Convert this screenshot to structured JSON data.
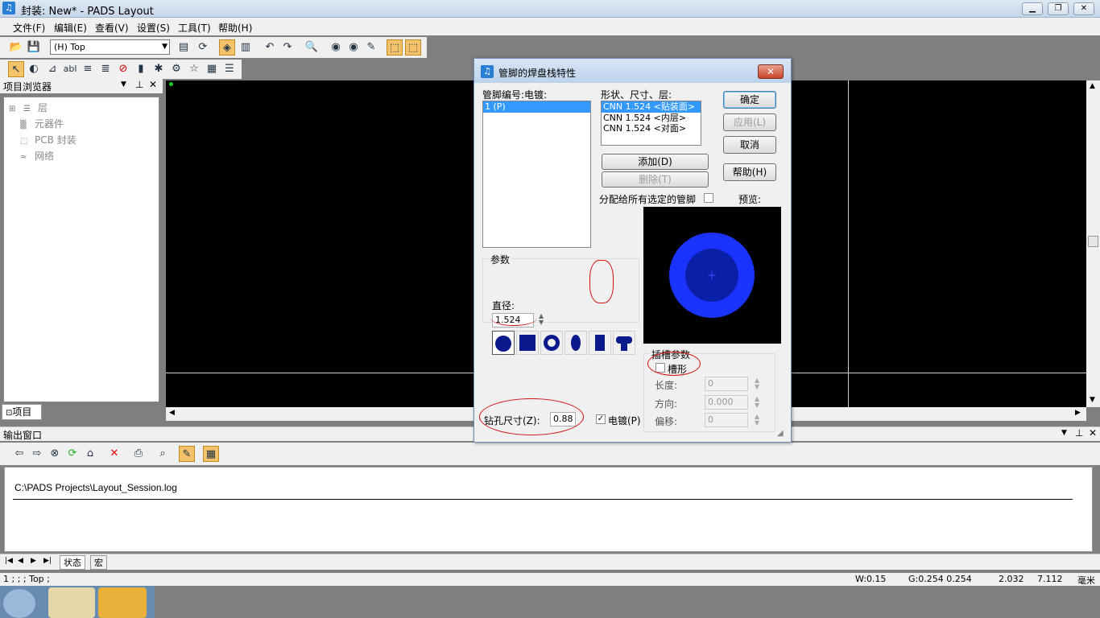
{
  "window": {
    "title": "封装: New* - PADS Layout",
    "min": "▁",
    "max": "❐",
    "close": "✕"
  },
  "menubar": [
    "文件(F)",
    "编辑(E)",
    "查看(V)",
    "设置(S)",
    "工具(T)",
    "帮助(H)"
  ],
  "toolbar": {
    "layer_select": "(H) Top"
  },
  "browser": {
    "title": "项目浏览器",
    "items": [
      "层",
      "元器件",
      "PCB 封装",
      "网络"
    ],
    "tab": "项目"
  },
  "output": {
    "title": "输出窗口",
    "log_path": "C:\\PADS Projects\\Layout_Session.log",
    "tabs": [
      "状态",
      "宏"
    ]
  },
  "statusbar": {
    "left": "1 ; ; ; Top ;",
    "w": "W:0.15",
    "g": "G:0.254 0.254",
    "x": "2.032",
    "y": "7.112",
    "unit": "毫米"
  },
  "dialog": {
    "title": "管脚的焊盘栈特性",
    "pin_label": "管脚编号:电镀:",
    "pins": [
      "1 (P)"
    ],
    "shape_label": "形状、尺寸、层:",
    "shapes": [
      "CNN 1.524 <贴装面>",
      "CNN 1.524 <内层>",
      "CNN 1.524 <对面>"
    ],
    "buttons": {
      "ok": "确定",
      "apply": "应用(L)",
      "cancel": "取消",
      "help": "帮助(H)",
      "add": "添加(D)",
      "delete": "删除(T)"
    },
    "assign_all": "分配给所有选定的管脚",
    "preview_label": "预览:",
    "params_label": "参数",
    "diameter_label": "直径:",
    "diameter_value": "1.524",
    "slot_group": "插槽参数",
    "slot_label": "槽形",
    "length_label": "长度:",
    "length_value": "0",
    "orient_label": "方向:",
    "orient_value": "0.000",
    "offset_label": "偏移:",
    "offset_value": "0",
    "drill_label": "钻孔尺寸(Z):",
    "drill_value": "0.88",
    "plated_label": "电镀(P)",
    "plated_checked": "✓",
    "colors": {
      "pad_outer": "#1a33ff",
      "pad_inner": "#0a1ea8"
    }
  }
}
